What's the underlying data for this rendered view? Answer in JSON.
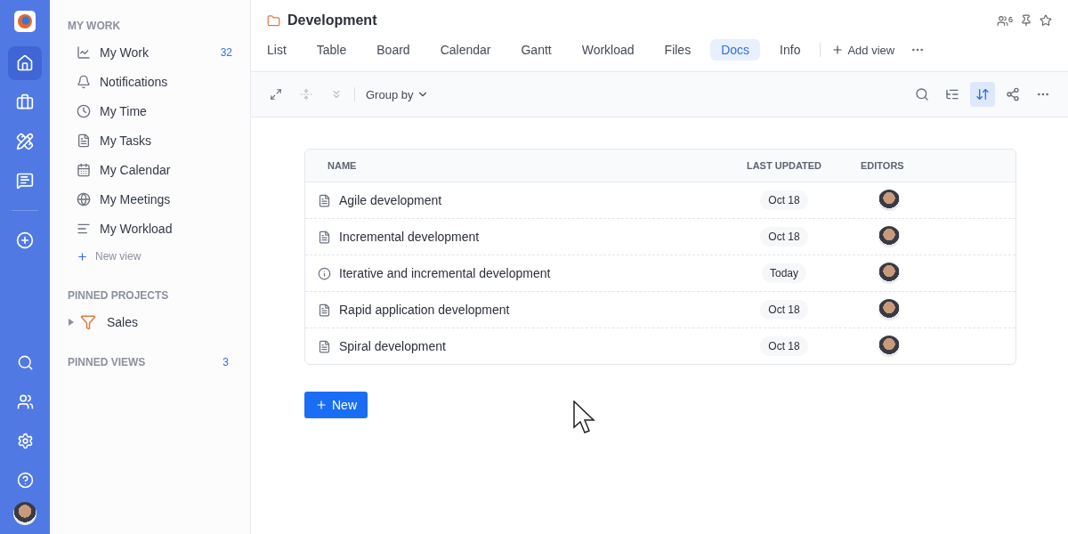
{
  "rail": {
    "top": [
      {
        "selected": true
      },
      {
        "selected": false
      },
      {
        "selected": false
      },
      {
        "selected": false
      }
    ]
  },
  "sidebar": {
    "my_work_heading": "MY WORK",
    "items": [
      {
        "label": "My Work",
        "count": "32"
      },
      {
        "label": "Notifications"
      },
      {
        "label": "My Time"
      },
      {
        "label": "My Tasks"
      },
      {
        "label": "My Calendar"
      },
      {
        "label": "My Meetings"
      },
      {
        "label": "My Workload"
      }
    ],
    "new_view": "New view",
    "pinned_projects_heading": "PINNED PROJECTS",
    "pinned_projects": [
      {
        "label": "Sales",
        "expanded": false
      }
    ],
    "pinned_views_heading": "PINNED VIEWS",
    "pinned_views_count": "3"
  },
  "header": {
    "title": "Development",
    "members_count": "6"
  },
  "tabs": [
    {
      "label": "List",
      "selected": false
    },
    {
      "label": "Table",
      "selected": false
    },
    {
      "label": "Board",
      "selected": false
    },
    {
      "label": "Calendar",
      "selected": false
    },
    {
      "label": "Gantt",
      "selected": false
    },
    {
      "label": "Workload",
      "selected": false
    },
    {
      "label": "Files",
      "selected": false
    },
    {
      "label": "Docs",
      "selected": true
    },
    {
      "label": "Info",
      "selected": false
    }
  ],
  "add_view": "Add view",
  "toolbar": {
    "group_by": "Group by",
    "sort_active": true
  },
  "table": {
    "columns": [
      "NAME",
      "LAST UPDATED",
      "EDITORS"
    ],
    "rows": [
      {
        "kind": "doc",
        "name": "Agile development",
        "updated": "Oct 18"
      },
      {
        "kind": "doc",
        "name": "Incremental development",
        "updated": "Oct 18"
      },
      {
        "kind": "info",
        "name": "Iterative and incremental development",
        "updated": "Today"
      },
      {
        "kind": "doc",
        "name": "Rapid application development",
        "updated": "Oct 18"
      },
      {
        "kind": "doc",
        "name": "Spiral development",
        "updated": "Oct 18"
      }
    ]
  },
  "new_button": "New"
}
